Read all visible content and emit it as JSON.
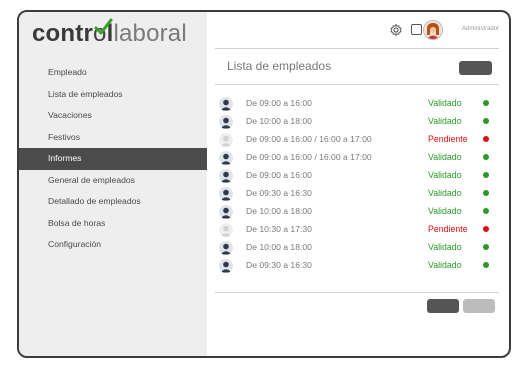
{
  "logo": {
    "part1": "contr",
    "part2": "l",
    "part3": "laboral"
  },
  "header": {
    "user_label": "Administrador"
  },
  "sidebar": {
    "items": [
      {
        "label": "Empleado"
      },
      {
        "label": "Lista de empleados"
      },
      {
        "label": "Vacaciones"
      },
      {
        "label": "Festivos"
      },
      {
        "label": "Informes",
        "active": true
      },
      {
        "label": "General de empleados"
      },
      {
        "label": "Detallado de empleados"
      },
      {
        "label": "Bolsa de horas"
      },
      {
        "label": "Configuración"
      }
    ]
  },
  "main": {
    "title": "Lista de empleados",
    "rows": [
      {
        "schedule": "De 09:00 a 16:00",
        "status": "Validado",
        "color": "#2a9a2a",
        "avatar": "dark"
      },
      {
        "schedule": "De 10:00 a 18:00",
        "status": "Validado",
        "color": "#2a9a2a",
        "avatar": "dark"
      },
      {
        "schedule": "De 09:00 a 16:00 / 16:00 a 17:00",
        "status": "Pendiente",
        "color": "#dd1111",
        "avatar": "light"
      },
      {
        "schedule": "De 09:00 a 16:00 / 16:00 a 17:00",
        "status": "Validado",
        "color": "#2a9a2a",
        "avatar": "dark"
      },
      {
        "schedule": "De 09:00 a 16:00",
        "status": "Validado",
        "color": "#2a9a2a",
        "avatar": "dark"
      },
      {
        "schedule": "De 09:30 a 16:30",
        "status": "Validado",
        "color": "#2a9a2a",
        "avatar": "dark"
      },
      {
        "schedule": "De 10:00 a 18:00",
        "status": "Validado",
        "color": "#2a9a2a",
        "avatar": "dark"
      },
      {
        "schedule": "De 10:30 a 17:30",
        "status": "Pendiente",
        "color": "#dd1111",
        "avatar": "light"
      },
      {
        "schedule": "De 10:00 a 18:00",
        "status": "Validado",
        "color": "#2a9a2a",
        "avatar": "dark"
      },
      {
        "schedule": "De 09:30 a 16:30",
        "status": "Validado",
        "color": "#2a9a2a",
        "avatar": "dark"
      }
    ]
  },
  "colors": {
    "accent_green": "#3aa02a",
    "sidebar_bg": "#eeeeee",
    "active_bg": "#4b4b4b"
  }
}
